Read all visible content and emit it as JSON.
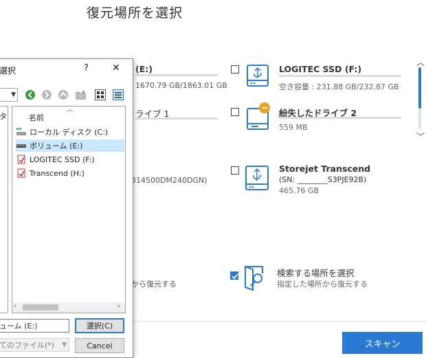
{
  "page_title": "復元場所を選択",
  "drives": {
    "partial_left": {
      "e_name": "(E:)",
      "e_size": "1670.79 GB/1863.01 GB",
      "drive1_name": "ライブ 1",
      "serial": "314500DM240DGN)",
      "location_desc": "から復元する"
    },
    "logitec": {
      "name": "LOGITEC SSD (F:)",
      "size": "空き容量 : 231.88 GB/232.87 GB"
    },
    "lost": {
      "name": "紛失したドライブ 2",
      "size": "559 MB"
    },
    "storejet": {
      "name": "Storejet Transcend",
      "serial": "(SN: ________S3PJE92B)",
      "size": "465.76 GB"
    },
    "select_location": {
      "name": "検索する場所を選択",
      "desc": "指定した場所から復元する"
    }
  },
  "scan_button": "スキャン",
  "dialog": {
    "title": "選択",
    "help": "?",
    "close": "✕",
    "left_pane_text": "タ",
    "column_header": "名前",
    "items": [
      {
        "label": "ローカル ディスク (C:)"
      },
      {
        "label": "ボリューム (E:)"
      },
      {
        "label": "LOGITEC SSD (F:)"
      },
      {
        "label": "Transcend (H:)"
      }
    ],
    "filename_value": "ューム (E:)",
    "select_button": "選択(C)",
    "filetype_value": "てのファイル(*)",
    "cancel_button": "Cancel"
  },
  "colors": {
    "accent": "#2a7ad3",
    "lost_badge": "#f0a020"
  }
}
